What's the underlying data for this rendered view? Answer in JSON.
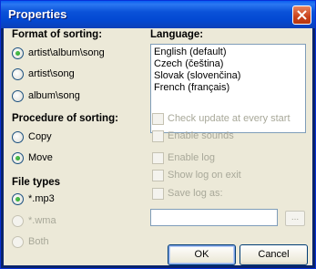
{
  "window": {
    "title": "Properties"
  },
  "format_sorting": {
    "header": "Format of sorting:",
    "options": [
      "artist\\album\\song",
      "artist\\song",
      "album\\song"
    ],
    "selected_index": 0
  },
  "procedure_sorting": {
    "header": "Procedure of sorting:",
    "options": [
      "Copy",
      "Move"
    ],
    "selected_index": 1
  },
  "file_types": {
    "header": "File types",
    "options": [
      "*.mp3",
      "*.wma",
      "Both"
    ],
    "selected_index": 0,
    "disabled_options": [
      "*.wma",
      "Both"
    ]
  },
  "language": {
    "header": "Language:",
    "items": [
      "English (default)",
      "Czech (čeština)",
      "Slovak (slovenčina)",
      "French (français)"
    ]
  },
  "options": {
    "check_update": "Check update at every start",
    "enable_sounds": "Enable sounds",
    "enable_log": "Enable log",
    "show_log_on_exit": "Show log on exit",
    "save_log_as": "Save log as:",
    "log_path_value": "",
    "browse_label": "..."
  },
  "buttons": {
    "ok": "OK",
    "cancel": "Cancel"
  },
  "colors": {
    "titlebar": "#0a52d8",
    "dialog_bg": "#ece9d8",
    "disabled_text": "#a8a899",
    "radio_dot": "#21a121"
  }
}
